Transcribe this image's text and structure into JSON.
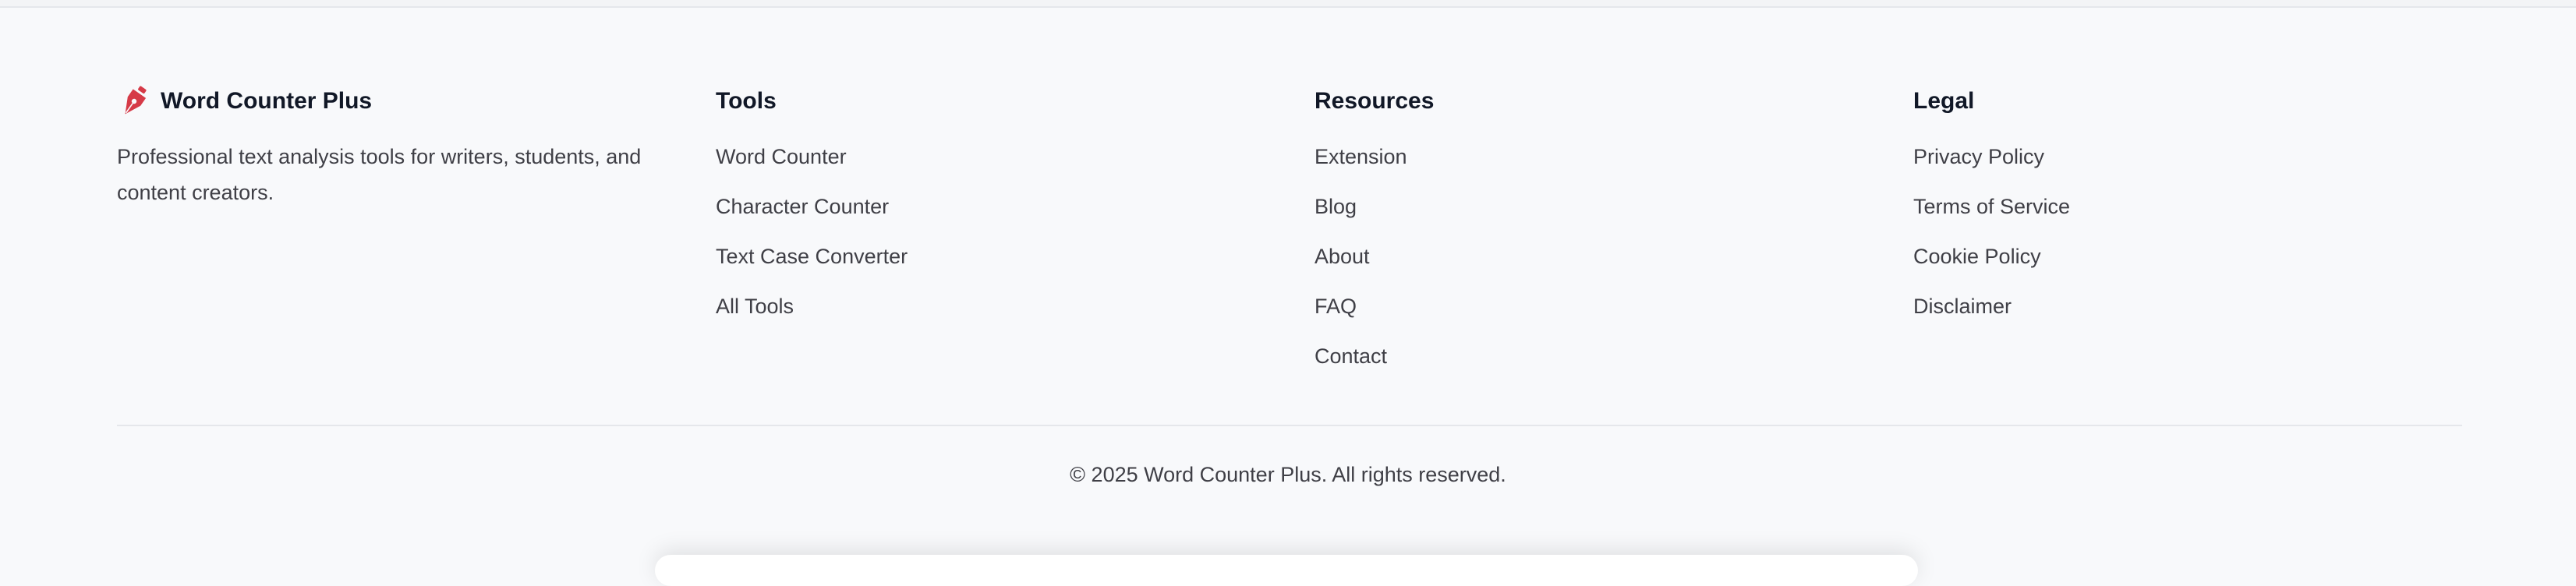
{
  "brand": {
    "name": "Word Counter Plus",
    "description": "Professional text analysis tools for writers, students, and content creators.",
    "icon": "pen-nib-icon",
    "accent_color": "#d63a47"
  },
  "columns": {
    "tools": {
      "title": "Tools",
      "links": [
        "Word Counter",
        "Character Counter",
        "Text Case Converter",
        "All Tools"
      ]
    },
    "resources": {
      "title": "Resources",
      "links": [
        "Extension",
        "Blog",
        "About",
        "FAQ",
        "Contact"
      ]
    },
    "legal": {
      "title": "Legal",
      "links": [
        "Privacy Policy",
        "Terms of Service",
        "Cookie Policy",
        "Disclaimer"
      ]
    }
  },
  "copyright": "© 2025 Word Counter Plus. All rights reserved."
}
